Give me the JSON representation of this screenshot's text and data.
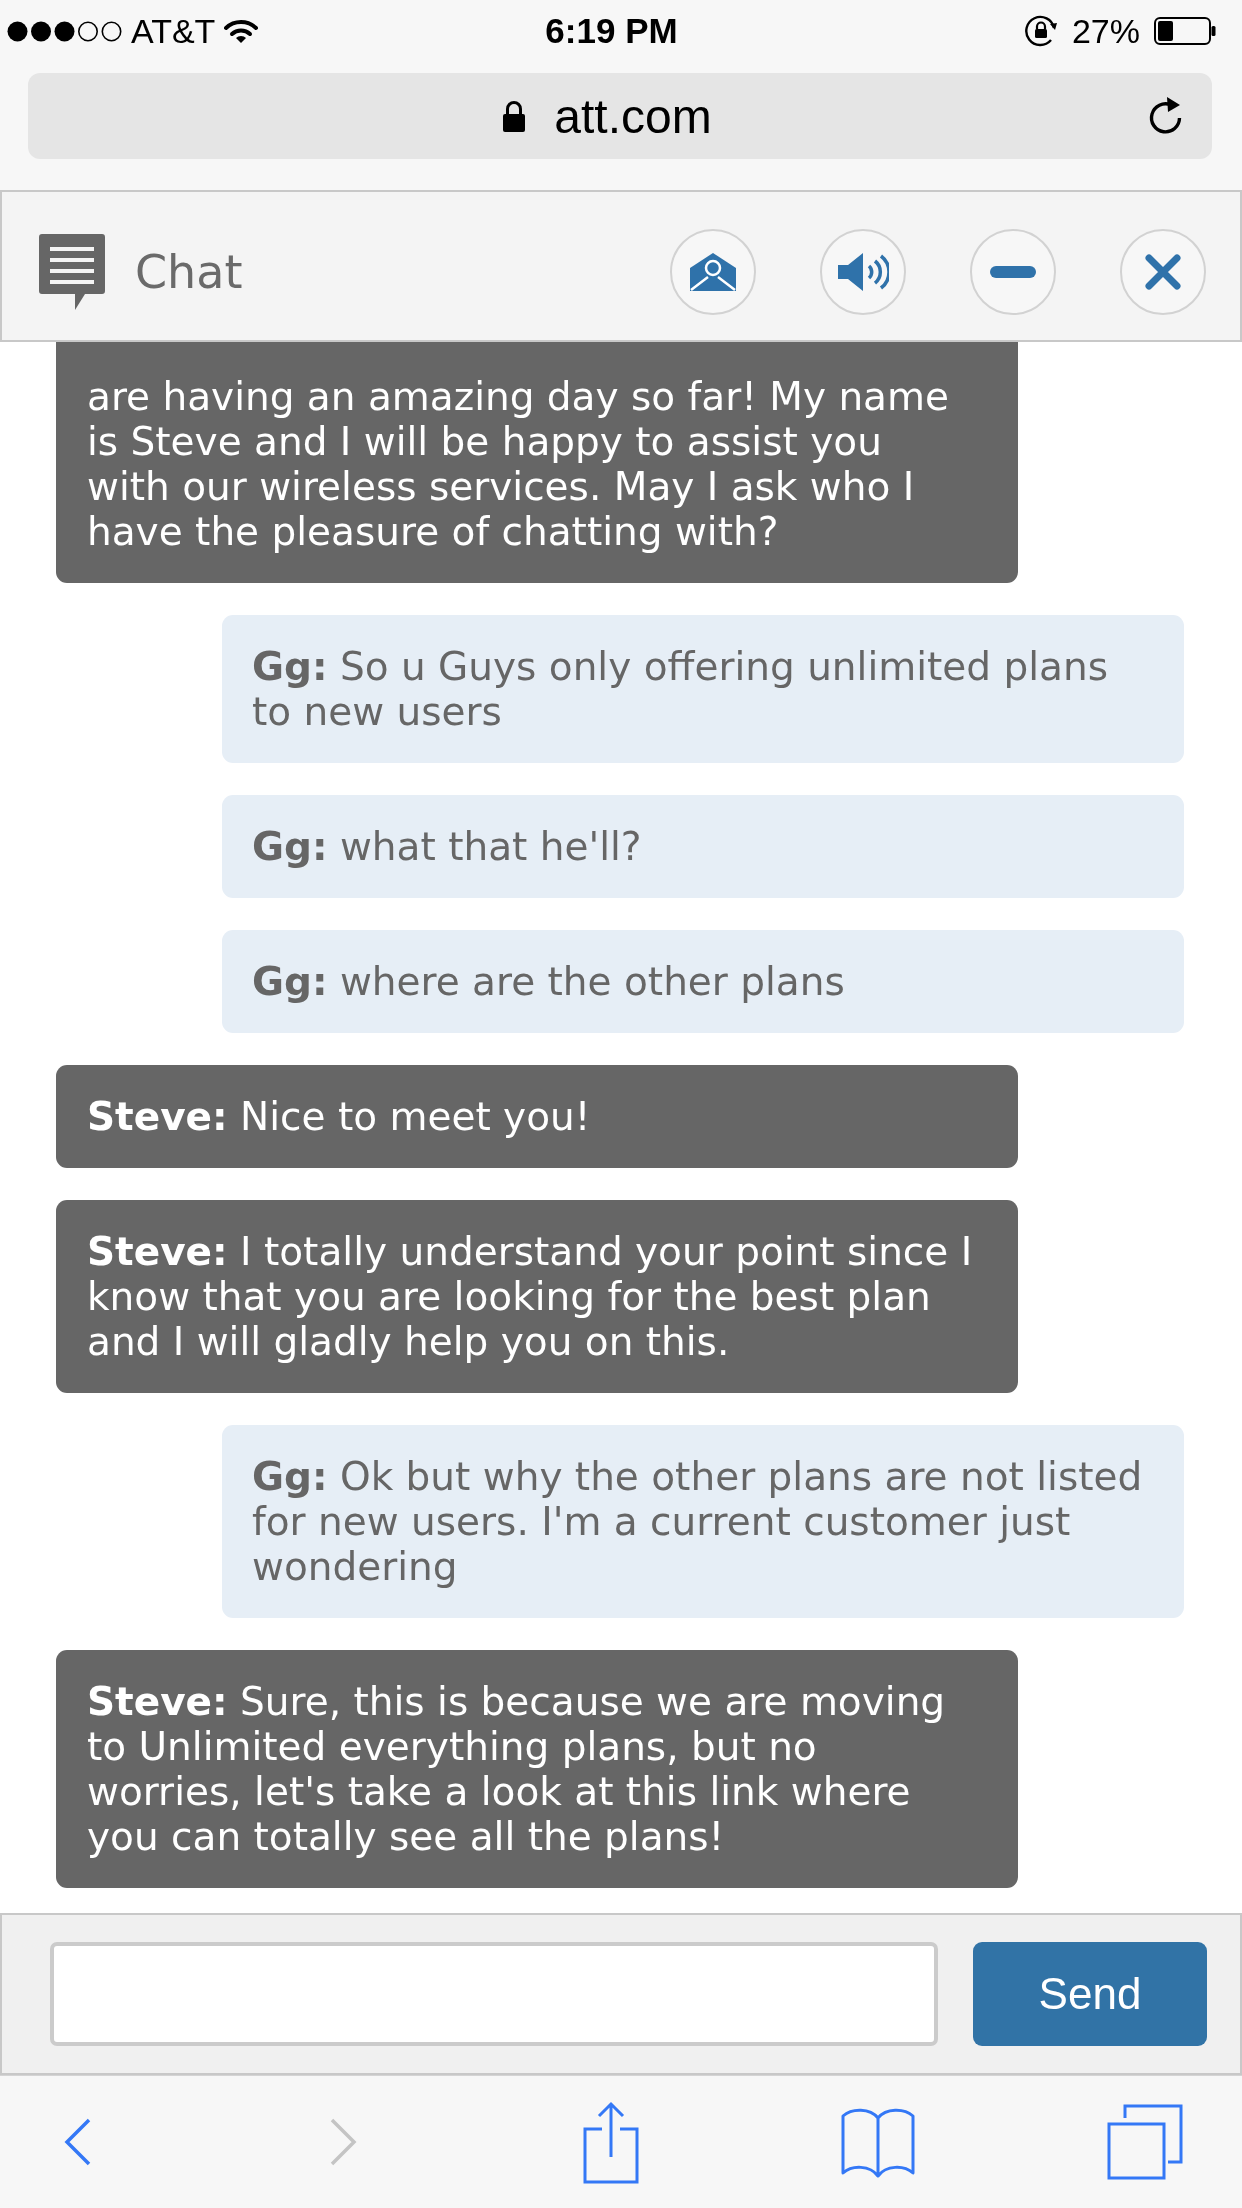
{
  "status_bar": {
    "carrier": "AT&T",
    "time": "6:19 PM",
    "battery": "27%"
  },
  "address_bar": {
    "url": "att.com"
  },
  "chat": {
    "title": "Chat",
    "messages": [
      {
        "kind": "agent",
        "text": "are having an amazing day so far! My name is Steve and I will be happy to assist you with our wireless services. May I ask who I have the pleasure of chatting with?"
      },
      {
        "kind": "user",
        "text": "**Gg:** So u Guys only offering unlimited plans to new users"
      },
      {
        "kind": "user",
        "text": "**Gg:** what that he'll?"
      },
      {
        "kind": "user",
        "text": "**Gg:** where are the other plans"
      },
      {
        "kind": "agent",
        "text": "**Steve:** Nice to meet you!"
      },
      {
        "kind": "agent",
        "text": "**Steve:** I totally understand your point since I know that you are looking for the best plan and I will gladly help you on this."
      },
      {
        "kind": "user",
        "text": "**Gg:** Ok but why the other plans are not listed for new users. I'm a current customer just wondering"
      },
      {
        "kind": "agent",
        "text": "**Steve:** Sure, this is because we are moving to Unlimited everything plans, but no worries, let's take a look at this link where you can totally see all the plans!"
      }
    ],
    "send_button": "Send"
  },
  "toolbar": [
    {
      "kind": "back",
      "disabled": false
    },
    {
      "kind": "forward",
      "disabled": true
    },
    {
      "kind": "share",
      "disabled": false
    },
    {
      "kind": "bookmarks",
      "disabled": false
    },
    {
      "kind": "tabs",
      "disabled": false
    }
  ]
}
